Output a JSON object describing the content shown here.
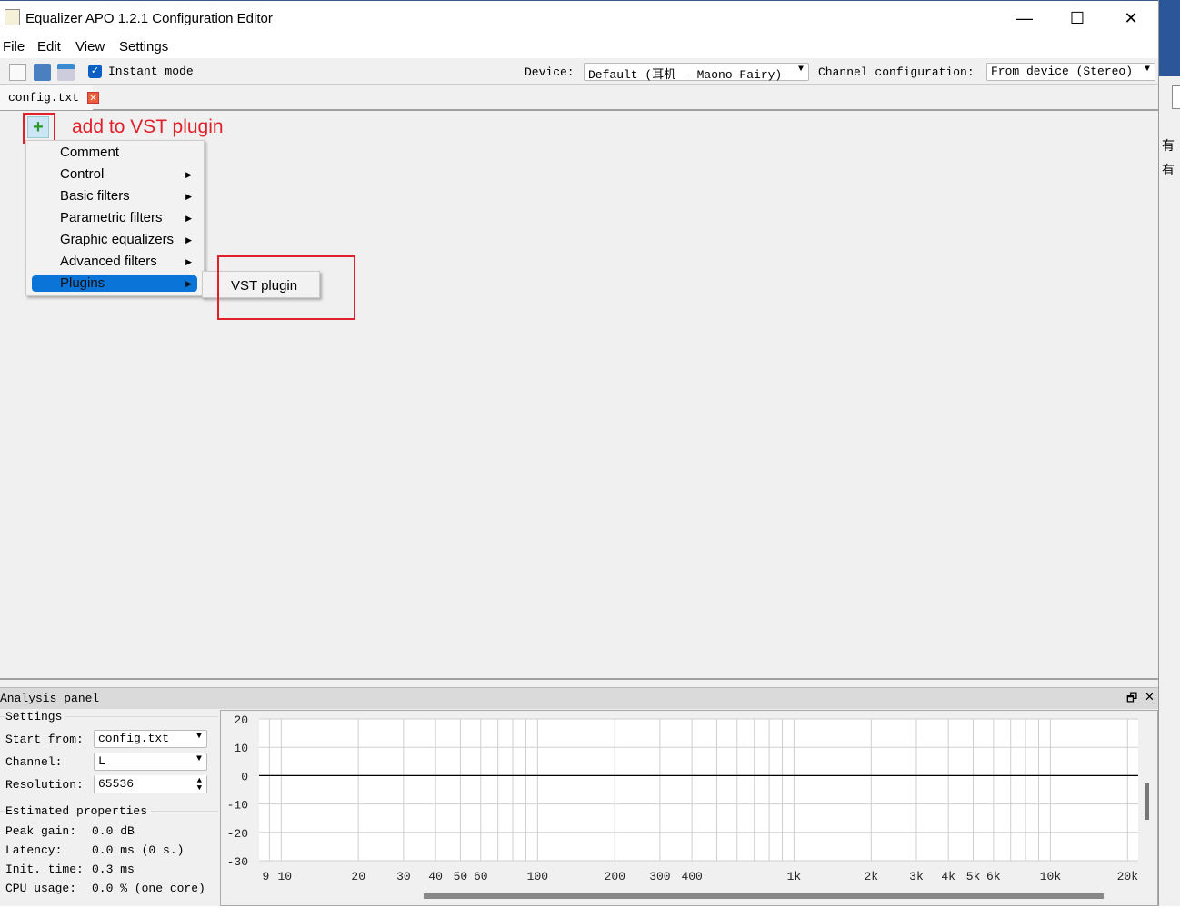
{
  "window": {
    "title": "Equalizer APO 1.2.1 Configuration Editor",
    "minimize": "—",
    "maximize": "☐",
    "close": "✕"
  },
  "menubar": [
    "File",
    "Edit",
    "View",
    "Settings"
  ],
  "toolbar": {
    "instant_mode": "Instant mode",
    "instant_mode_checked": true,
    "device_label": "Device:",
    "device_value": "Default (耳机 - Maono Fairy)",
    "channel_label": "Channel configuration:",
    "channel_value": "From device (Stereo)"
  },
  "tab": {
    "label": "config.txt"
  },
  "annotation": {
    "text": "add to VST plugin",
    "color": "#e0202a"
  },
  "add_menu": {
    "items": [
      {
        "label": "Comment",
        "submenu": false
      },
      {
        "label": "Control",
        "submenu": true
      },
      {
        "label": "Basic filters",
        "submenu": true
      },
      {
        "label": "Parametric filters",
        "submenu": true
      },
      {
        "label": "Graphic equalizers",
        "submenu": true
      },
      {
        "label": "Advanced filters",
        "submenu": true
      },
      {
        "label": "Plugins",
        "submenu": true,
        "selected": true
      }
    ],
    "submenu": [
      "VST plugin"
    ]
  },
  "analysis": {
    "title": "Analysis panel",
    "settings_title": "Settings",
    "start_from_label": "Start from:",
    "start_from_value": "config.txt",
    "channel_label": "Channel:",
    "channel_value": "L",
    "resolution_label": "Resolution:",
    "resolution_value": "65536",
    "estimated_title": "Estimated properties",
    "props": [
      {
        "label": "Peak gain:",
        "value": "0.0 dB"
      },
      {
        "label": "Latency:",
        "value": "0.0 ms (0 s.)"
      },
      {
        "label": "Init. time:",
        "value": "0.3 ms"
      },
      {
        "label": "CPU usage:",
        "value": "0.0 % (one core)"
      }
    ]
  },
  "chart_data": {
    "type": "line",
    "x_scale": "log",
    "xlim": [
      8.2,
      22000
    ],
    "ylim": [
      -30,
      20
    ],
    "grid": true,
    "y_ticks": [
      "20",
      "10",
      "0",
      "-10",
      "-20",
      "-30"
    ],
    "x_ticks": [
      {
        "v": 9,
        "l": "9"
      },
      {
        "v": 10,
        "l": "10"
      },
      {
        "v": 20,
        "l": "20"
      },
      {
        "v": 30,
        "l": "30"
      },
      {
        "v": 40,
        "l": "40"
      },
      {
        "v": 50,
        "l": "50"
      },
      {
        "v": 60,
        "l": "60"
      },
      {
        "v": 100,
        "l": "100"
      },
      {
        "v": 200,
        "l": "200"
      },
      {
        "v": 300,
        "l": "300"
      },
      {
        "v": 400,
        "l": "400"
      },
      {
        "v": 1000,
        "l": "1k"
      },
      {
        "v": 2000,
        "l": "2k"
      },
      {
        "v": 3000,
        "l": "3k"
      },
      {
        "v": 4000,
        "l": "4k"
      },
      {
        "v": 5000,
        "l": "5k"
      },
      {
        "v": 6000,
        "l": "6k"
      },
      {
        "v": 10000,
        "l": "10k"
      },
      {
        "v": 20000,
        "l": "20k"
      }
    ],
    "series": [
      {
        "x": [
          8.2,
          22000
        ],
        "y": [
          0,
          0
        ]
      }
    ]
  },
  "background_window": {
    "chars": [
      "有",
      "有"
    ],
    "accent": "#2b579a"
  }
}
